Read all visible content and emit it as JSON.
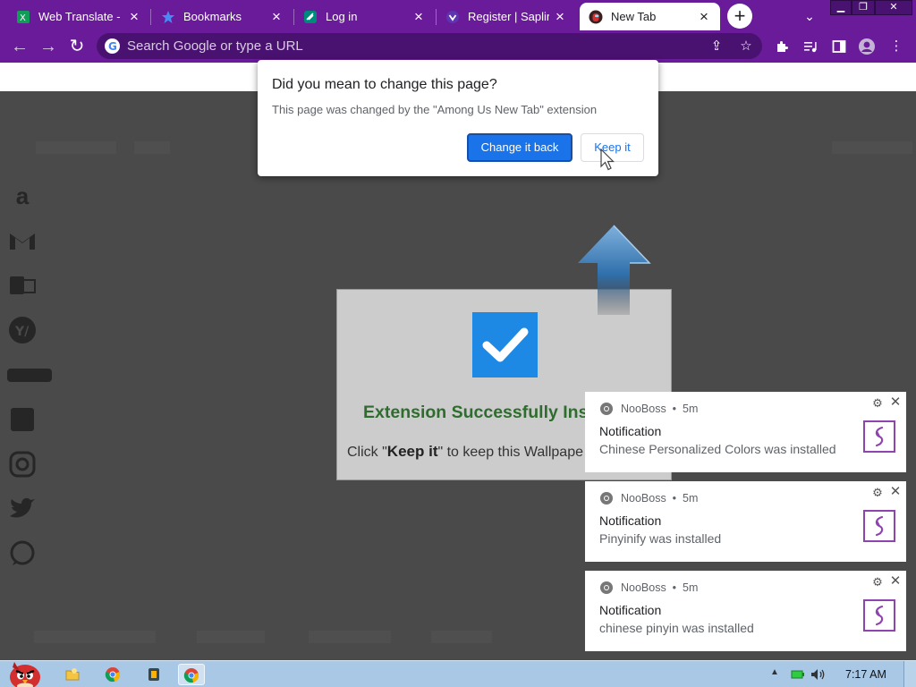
{
  "browser": {
    "tabs": [
      {
        "title": "Web Translate -",
        "favicon": "translate-icon",
        "active": false
      },
      {
        "title": "Bookmarks",
        "favicon": "star-icon",
        "active": false
      },
      {
        "title": "Log in",
        "favicon": "login-icon",
        "active": false
      },
      {
        "title": "Register | Saplin",
        "favicon": "sapling-icon",
        "active": false
      },
      {
        "title": "New Tab",
        "favicon": "among-us-icon",
        "active": true
      }
    ],
    "new_tab_symbol": "+",
    "omnibox": {
      "placeholder": "Search Google or type a URL"
    },
    "theme_color": "#6a1b9a"
  },
  "dialog": {
    "title": "Did you mean to change this page?",
    "message": "This page was changed by the \"Among Us New Tab\" extension",
    "primary_button": "Change it back",
    "secondary_button": "Keep it"
  },
  "extension_card": {
    "title": "Extension Successfully Ins",
    "body_prefix": "Click \"",
    "body_bold": "Keep it",
    "body_suffix": "\" to keep this Wallpape"
  },
  "notifications": [
    {
      "source": "NooBoss",
      "time": "5m",
      "title": "Notification",
      "body": "Chinese Personalized Colors was installed"
    },
    {
      "source": "NooBoss",
      "time": "5m",
      "title": "Notification",
      "body": "Pinyinify was installed"
    },
    {
      "source": "NooBoss",
      "time": "5m",
      "title": "Notification",
      "body": "chinese pinyin was installed"
    }
  ],
  "taskbar": {
    "clock": "7:17 AM"
  },
  "colors": {
    "accent_blue": "#1a73e8",
    "success_green": "#2e6d2e",
    "check_blue": "#1e88e5"
  }
}
